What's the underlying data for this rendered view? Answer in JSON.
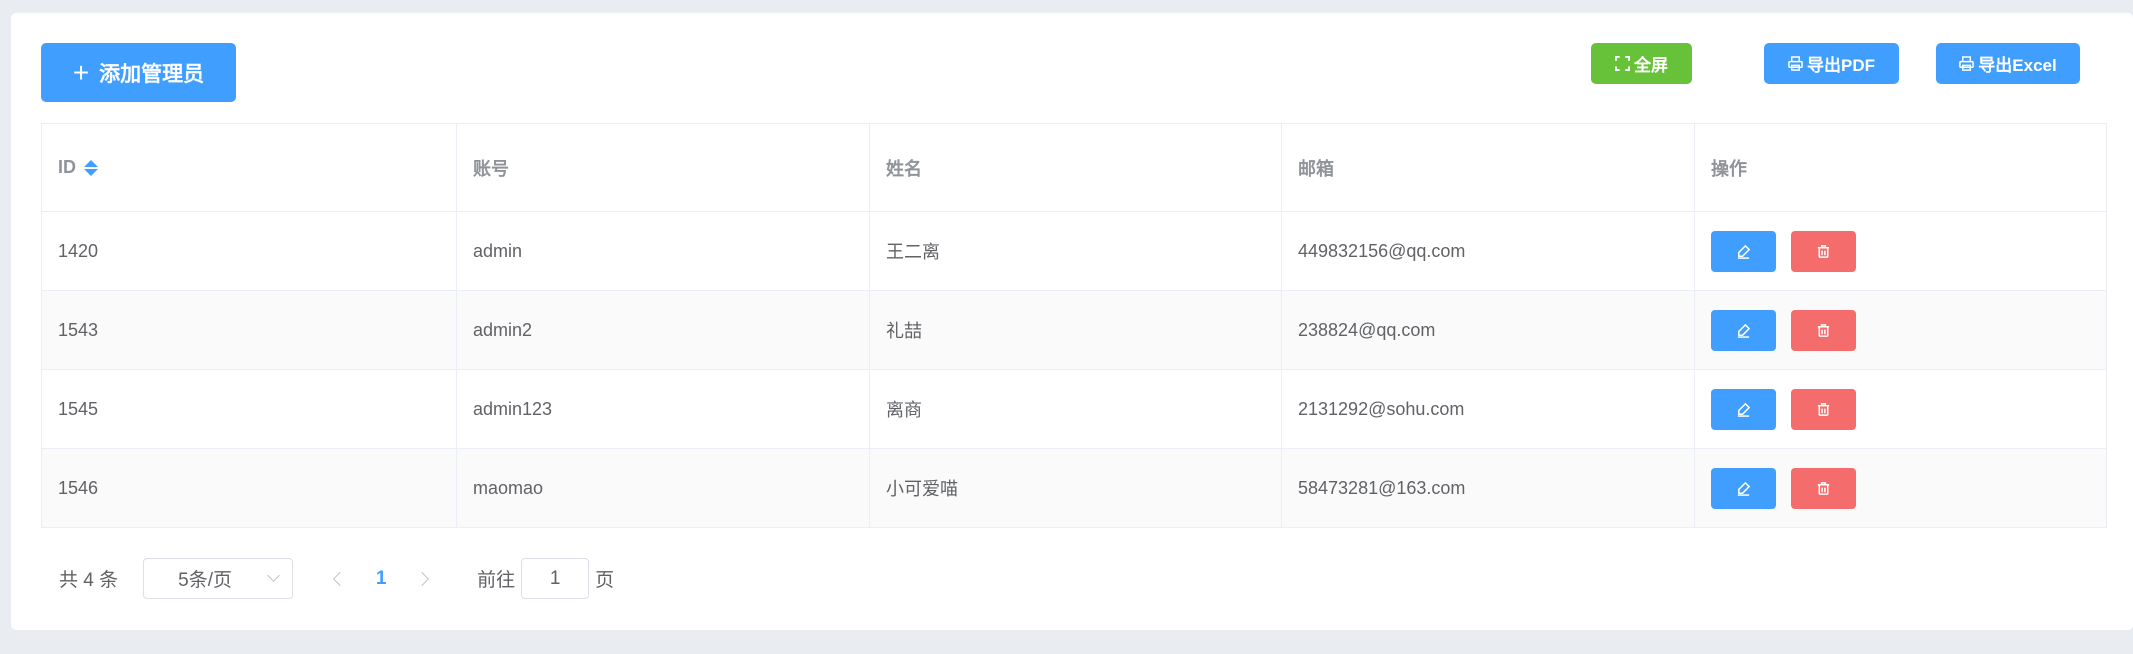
{
  "toolbar": {
    "add_label": "添加管理员",
    "fullscreen_label": "全屏",
    "pdf_label": "导出PDF",
    "excel_label": "导出Excel"
  },
  "table": {
    "columns": [
      "ID",
      "账号",
      "姓名",
      "邮箱",
      "操作"
    ],
    "rows": [
      {
        "id": "1420",
        "account": "admin",
        "name": "王二离",
        "email": "449832156@qq.com"
      },
      {
        "id": "1543",
        "account": "admin2",
        "name": "礼喆",
        "email": "238824@qq.com"
      },
      {
        "id": "1545",
        "account": "admin123",
        "name": "离商",
        "email": "2131292@sohu.com"
      },
      {
        "id": "1546",
        "account": "maomao",
        "name": "小可爱喵",
        "email": "58473281@163.com"
      }
    ],
    "row_actions": [
      "edit-icon",
      "delete-icon"
    ]
  },
  "pagination": {
    "total": "共 4 条",
    "page_size": "5条/页",
    "current_page": "1",
    "goto_label": "前往",
    "goto_value": "1",
    "page_suffix": "页"
  },
  "colors": {
    "primary": "#409eff",
    "success": "#67c23a",
    "danger": "#f56c6c",
    "background": "#e9edf2"
  }
}
